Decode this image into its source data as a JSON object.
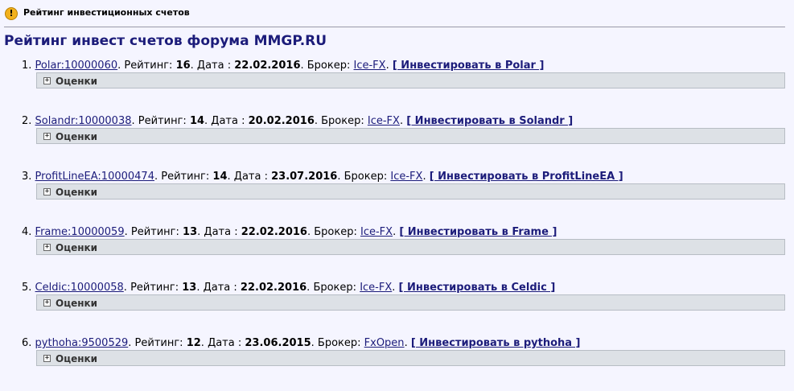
{
  "topbar": {
    "title": "Рейтинг инвестиционных счетов",
    "icon": "warning-icon"
  },
  "heading": "Рейтинг инвест счетов форума MMGP.RU",
  "labels": {
    "rating": "Рейтинг:",
    "date": "Дата :",
    "broker": "Брокер:",
    "ocenki": "Оценки"
  },
  "items": [
    {
      "num": "1.",
      "account": "Polar:10000060",
      "rating": "16",
      "date": "22.02.2016",
      "broker": "Ice-FX",
      "invest": "[ Инвестировать в Polar ]"
    },
    {
      "num": "2.",
      "account": "Solandr:10000038",
      "rating": "14",
      "date": "20.02.2016",
      "broker": "Ice-FX",
      "invest": "[ Инвестировать в Solandr ]"
    },
    {
      "num": "3.",
      "account": "ProfitLineEA:10000474",
      "rating": "14",
      "date": "23.07.2016",
      "broker": "Ice-FX",
      "invest": "[ Инвестировать в ProfitLineEA ]"
    },
    {
      "num": "4.",
      "account": "Frame:10000059",
      "rating": "13",
      "date": "22.02.2016",
      "broker": "Ice-FX",
      "invest": "[ Инвестировать в Frame ]"
    },
    {
      "num": "5.",
      "account": "Celdic:10000058",
      "rating": "13",
      "date": "22.02.2016",
      "broker": "Ice-FX",
      "invest": "[ Инвестировать в Celdic ]"
    },
    {
      "num": "6.",
      "account": "pythoha:9500529",
      "rating": "12",
      "date": "23.06.2015",
      "broker": "FxOpen",
      "invest": "[ Инвестировать в pythoha ]"
    }
  ],
  "colors": {
    "link": "#1c1c7a",
    "heading": "#1c1c7a",
    "collapse_bar": "#dde1e6",
    "background": "#f5f5ff",
    "warning": "#f2b11c"
  }
}
